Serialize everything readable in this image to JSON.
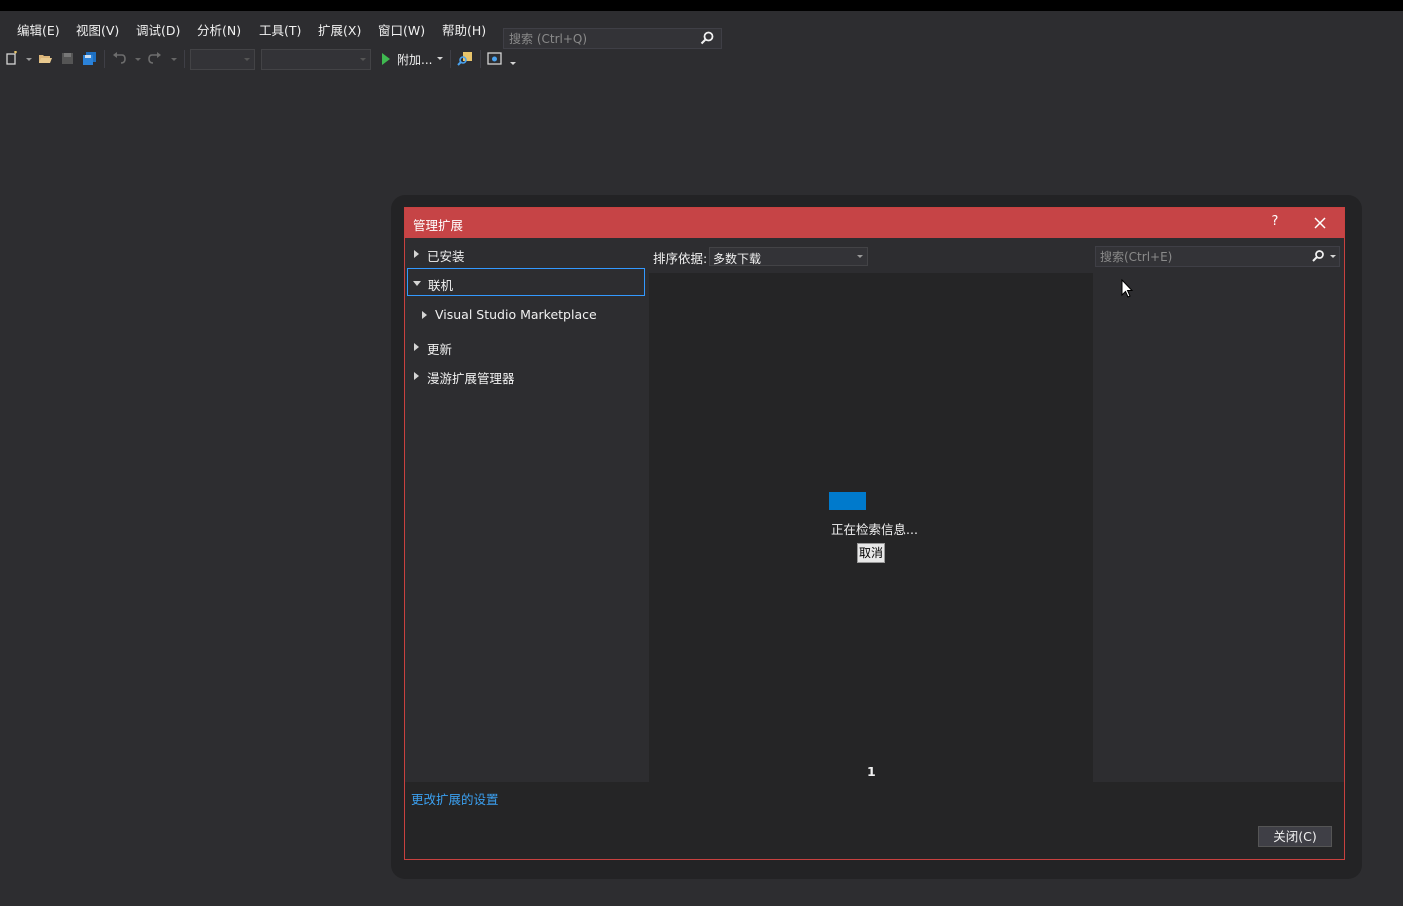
{
  "menu": {
    "items": [
      {
        "label": "编辑(E)"
      },
      {
        "label": "视图(V)"
      },
      {
        "label": "调试(D)"
      },
      {
        "label": "分析(N)"
      },
      {
        "label": "工具(T)"
      },
      {
        "label": "扩展(X)"
      },
      {
        "label": "窗口(W)"
      },
      {
        "label": "帮助(H)"
      }
    ],
    "search_placeholder": "搜索 (Ctrl+Q)"
  },
  "toolbar": {
    "attach_label": "附加..."
  },
  "dialog": {
    "title": "管理扩展",
    "help_label": "?",
    "tree": {
      "installed": "已安装",
      "online": "联机",
      "marketplace": "Visual Studio Marketplace",
      "updates": "更新",
      "roaming": "漫游扩展管理器"
    },
    "sort": {
      "label": "排序依据:",
      "value": "多数下载"
    },
    "search_placeholder": "搜索(Ctrl+E)",
    "loading_text": "正在检索信息...",
    "cancel_label": "取消",
    "page_number": "1",
    "settings_link": "更改扩展的设置",
    "close_label": "关闭(C)"
  },
  "colors": {
    "title_bar": "#c64446",
    "accent": "#007acc",
    "link": "#3ba0f0",
    "selection_border": "#3399ff"
  }
}
